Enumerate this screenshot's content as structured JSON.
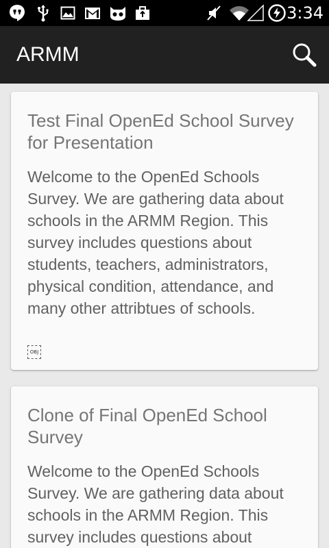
{
  "status_bar": {
    "time": "3:34",
    "icons": [
      "hangouts-icon",
      "usb-icon",
      "image-icon",
      "gmail-icon",
      "cat-icon",
      "briefcase-icon",
      "mute-icon",
      "wifi-icon",
      "signal-icon",
      "battery-charging-icon"
    ]
  },
  "app_bar": {
    "title": "ARMM",
    "search_icon": "search-icon"
  },
  "surveys": [
    {
      "title": "Test Final OpenEd School Survey for Presentation",
      "description": "Welcome to the OpenEd Schools Survey. We are gathering data about schools in the ARMM Region. This survey includes questions about students, teachers, administrators, physical condition, attendance, and many other attribtues of schools.",
      "object_label": "OBJ"
    },
    {
      "title": "Clone of Final OpenEd School Survey",
      "description": "Welcome to the OpenEd Schools Survey. We are gathering data about schools in the ARMM Region. This survey includes questions about"
    }
  ],
  "colors": {
    "status_bar": "#000000",
    "app_bar": "#212121",
    "background": "#e9e9e9",
    "card": "#fafafa",
    "title_text": "#757575",
    "body_text": "#616161"
  }
}
